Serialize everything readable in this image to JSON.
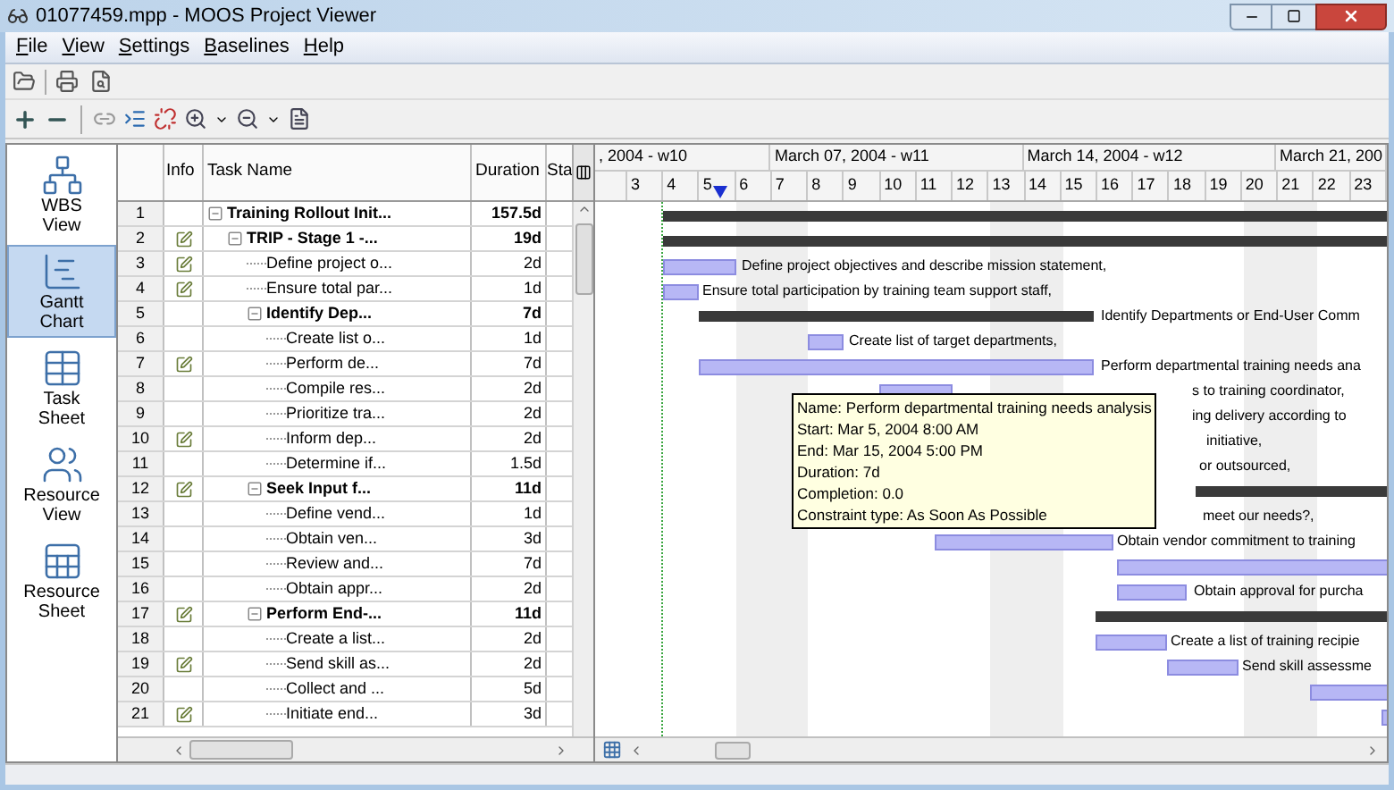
{
  "window": {
    "title": "01077459.mpp - MOOS Project Viewer"
  },
  "menu": [
    "File",
    "View",
    "Settings",
    "Baselines",
    "Help"
  ],
  "nav": [
    {
      "label": "WBS View",
      "selected": false
    },
    {
      "label": "Gantt Chart",
      "selected": true
    },
    {
      "label": "Task Sheet",
      "selected": false
    },
    {
      "label": "Resource View",
      "selected": false
    },
    {
      "label": "Resource Sheet",
      "selected": false
    }
  ],
  "table": {
    "columns": [
      "Info",
      "Task Name",
      "Duration",
      "Sta"
    ],
    "rows": [
      {
        "id": "1",
        "info": false,
        "name": "Training Rollout Init...",
        "duration": "157.5d",
        "expanded": true,
        "children": [
          {
            "id": "2",
            "info": true,
            "name": "TRIP - Stage 1 -...",
            "duration": "19d",
            "expanded": true,
            "children": [
              {
                "id": "3",
                "info": true,
                "name": "Define project o...",
                "duration": "2d",
                "bar_label": "Define project objectives and describe mission statement,"
              },
              {
                "id": "4",
                "info": true,
                "name": "Ensure total par...",
                "duration": "1d",
                "bar_label": "Ensure total participation by training team support staff,"
              },
              {
                "id": "5",
                "info": false,
                "name": "Identify Dep...",
                "duration": "7d",
                "expanded": true,
                "bar_label": "Identify Departments or End-User Comm",
                "children": [
                  {
                    "id": "6",
                    "info": false,
                    "name": "Create list o...",
                    "duration": "1d",
                    "bar_label": "Create list of target departments,"
                  },
                  {
                    "id": "7",
                    "info": true,
                    "name": "Perform de...",
                    "duration": "7d",
                    "bar_label": "Perform departmental training needs ana"
                  },
                  {
                    "id": "8",
                    "info": false,
                    "name": "Compile res...",
                    "duration": "2d",
                    "bar_label": "s to training coordinator,"
                  },
                  {
                    "id": "9",
                    "info": false,
                    "name": "Prioritize tra...",
                    "duration": "2d",
                    "bar_label": "ing delivery according to"
                  },
                  {
                    "id": "10",
                    "info": true,
                    "name": "Inform dep...",
                    "duration": "2d",
                    "bar_label": "initiative,"
                  },
                  {
                    "id": "11",
                    "info": false,
                    "name": "Determine if...",
                    "duration": "1.5d",
                    "bar_label": "or outsourced,"
                  }
                ]
              },
              {
                "id": "12",
                "info": true,
                "name": "Seek Input f...",
                "duration": "11d",
                "expanded": true,
                "children": [
                  {
                    "id": "13",
                    "info": false,
                    "name": "Define vend...",
                    "duration": "1d",
                    "bar_label": "meet our needs?,"
                  },
                  {
                    "id": "14",
                    "info": false,
                    "name": "Obtain ven...",
                    "duration": "3d",
                    "bar_label": "Obtain vendor commitment to training"
                  },
                  {
                    "id": "15",
                    "info": false,
                    "name": "Review and...",
                    "duration": "7d"
                  },
                  {
                    "id": "16",
                    "info": false,
                    "name": "Obtain appr...",
                    "duration": "2d",
                    "bar_label": "Obtain approval for purcha"
                  }
                ]
              },
              {
                "id": "17",
                "info": true,
                "name": "Perform End-...",
                "duration": "11d",
                "expanded": true,
                "children": [
                  {
                    "id": "18",
                    "info": false,
                    "name": "Create a list...",
                    "duration": "2d",
                    "bar_label": "Create a list of training recipie"
                  },
                  {
                    "id": "19",
                    "info": true,
                    "name": "Send skill as...",
                    "duration": "2d",
                    "bar_label": "Send skill assessme"
                  },
                  {
                    "id": "20",
                    "info": false,
                    "name": "Collect and ...",
                    "duration": "5d"
                  },
                  {
                    "id": "21",
                    "info": true,
                    "name": "Initiate end...",
                    "duration": "3d"
                  }
                ]
              }
            ]
          }
        ]
      }
    ]
  },
  "timeline": {
    "weeks": [
      ", 2004 - w10",
      "March 07, 2004 - w11",
      "March 14, 2004 - w12",
      "March 21, 200"
    ],
    "days": [
      {
        "label": "3",
        "today": false
      },
      {
        "label": "4",
        "today": false
      },
      {
        "label": "5",
        "today": true
      },
      {
        "label": "6",
        "today": false
      },
      {
        "label": "7",
        "today": false
      },
      {
        "label": "8",
        "today": false
      },
      {
        "label": "9",
        "today": false
      },
      {
        "label": "10",
        "today": false
      },
      {
        "label": "11",
        "today": false
      },
      {
        "label": "12",
        "today": false
      },
      {
        "label": "13",
        "today": false
      },
      {
        "label": "14",
        "today": false
      },
      {
        "label": "15",
        "today": false
      },
      {
        "label": "16",
        "today": false
      },
      {
        "label": "17",
        "today": false
      },
      {
        "label": "18",
        "today": false
      },
      {
        "label": "19",
        "today": false
      },
      {
        "label": "20",
        "today": false
      },
      {
        "label": "21",
        "today": false
      },
      {
        "label": "22",
        "today": false
      },
      {
        "label": "23",
        "today": false
      }
    ]
  },
  "tooltip": {
    "lines": [
      "Name: Perform departmental training needs analysis",
      "Start: Mar 5, 2004 8:00 AM",
      "End: Mar 15, 2004 5:00 PM",
      "Duration: 7d",
      "Completion: 0.0",
      "Constraint type: As Soon As Possible"
    ]
  }
}
